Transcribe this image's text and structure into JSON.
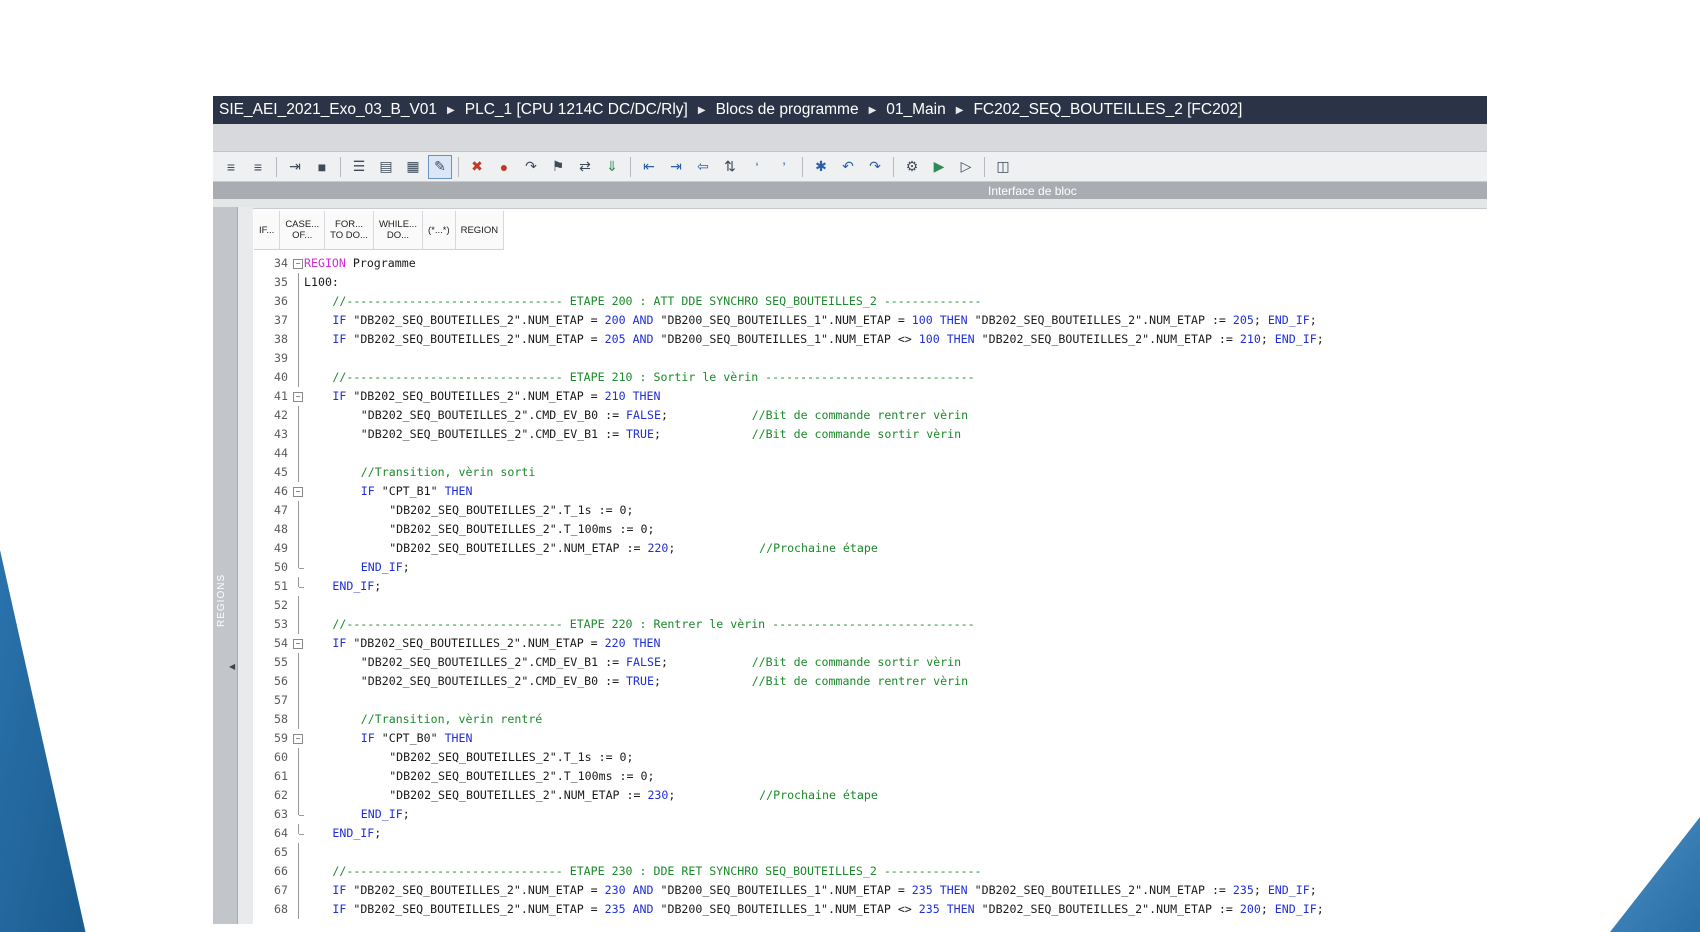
{
  "breadcrumb": [
    "SIE_AEI_2021_Exo_03_B_V01",
    "PLC_1 [CPU 1214C DC/DC/Rly]",
    "Blocs de programme",
    "01_Main",
    "FC202_SEQ_BOUTEILLES_2 [FC202]"
  ],
  "interface_label": "Interface de bloc",
  "regions_label": "REGIONS",
  "snippets": [
    {
      "l1": "IF...",
      "l2": ""
    },
    {
      "l1": "CASE...",
      "l2": "OF..."
    },
    {
      "l1": "FOR...",
      "l2": "TO DO..."
    },
    {
      "l1": "WHILE...",
      "l2": "DO..."
    },
    {
      "l1": "(*...*)",
      "l2": ""
    },
    {
      "l1": "REGION",
      "l2": ""
    }
  ],
  "code_lines": [
    {
      "n": "34",
      "fold": "box",
      "indent": 0,
      "parts": [
        [
          "kwr",
          "REGION"
        ],
        [
          "txt",
          " Programme"
        ]
      ]
    },
    {
      "n": "35",
      "fold": "vline",
      "indent": 0,
      "parts": [
        [
          "txt",
          "L100:"
        ]
      ]
    },
    {
      "n": "36",
      "fold": "vline",
      "indent": 1,
      "parts": [
        [
          "cmt",
          "//------------------------------- ETAPE 200 : ATT DDE SYNCHRO SEQ_BOUTEILLES_2 --------------"
        ]
      ]
    },
    {
      "n": "37",
      "fold": "vline",
      "indent": 1,
      "parts": [
        [
          "kw",
          "IF"
        ],
        [
          "txt",
          " \"DB202_SEQ_BOUTEILLES_2\".NUM_ETAP = "
        ],
        [
          "kw",
          "200"
        ],
        [
          "txt",
          " "
        ],
        [
          "kw",
          "AND"
        ],
        [
          "txt",
          " \"DB200_SEQ_BOUTEILLES_1\".NUM_ETAP = "
        ],
        [
          "kw",
          "100"
        ],
        [
          "txt",
          " "
        ],
        [
          "kw",
          "THEN"
        ],
        [
          "txt",
          " \"DB202_SEQ_BOUTEILLES_2\".NUM_ETAP := "
        ],
        [
          "kw",
          "205"
        ],
        [
          "txt",
          "; "
        ],
        [
          "kw",
          "END_IF"
        ],
        [
          "txt",
          ";"
        ]
      ]
    },
    {
      "n": "38",
      "fold": "vline",
      "indent": 1,
      "parts": [
        [
          "kw",
          "IF"
        ],
        [
          "txt",
          " \"DB202_SEQ_BOUTEILLES_2\".NUM_ETAP = "
        ],
        [
          "kw",
          "205"
        ],
        [
          "txt",
          " "
        ],
        [
          "kw",
          "AND"
        ],
        [
          "txt",
          " \"DB200_SEQ_BOUTEILLES_1\".NUM_ETAP <> "
        ],
        [
          "kw",
          "100"
        ],
        [
          "txt",
          " "
        ],
        [
          "kw",
          "THEN"
        ],
        [
          "txt",
          " \"DB202_SEQ_BOUTEILLES_2\".NUM_ETAP := "
        ],
        [
          "kw",
          "210"
        ],
        [
          "txt",
          "; "
        ],
        [
          "kw",
          "END_IF"
        ],
        [
          "txt",
          ";"
        ]
      ]
    },
    {
      "n": "39",
      "fold": "vline",
      "indent": 0,
      "parts": []
    },
    {
      "n": "40",
      "fold": "vline",
      "indent": 1,
      "parts": [
        [
          "cmt",
          "//------------------------------- ETAPE 210 : Sortir le vèrin ------------------------------"
        ]
      ]
    },
    {
      "n": "41",
      "fold": "box",
      "indent": 1,
      "parts": [
        [
          "kw",
          "IF"
        ],
        [
          "txt",
          " \"DB202_SEQ_BOUTEILLES_2\".NUM_ETAP = "
        ],
        [
          "kw",
          "210"
        ],
        [
          "txt",
          " "
        ],
        [
          "kw",
          "THEN"
        ]
      ]
    },
    {
      "n": "42",
      "fold": "vline",
      "indent": 2,
      "parts": [
        [
          "txt",
          "\"DB202_SEQ_BOUTEILLES_2\".CMD_EV_B0 := "
        ],
        [
          "kw",
          "FALSE"
        ],
        [
          "txt",
          ";            "
        ],
        [
          "cmt",
          "//Bit de commande rentrer vèrin"
        ]
      ]
    },
    {
      "n": "43",
      "fold": "vline",
      "indent": 2,
      "parts": [
        [
          "txt",
          "\"DB202_SEQ_BOUTEILLES_2\".CMD_EV_B1 := "
        ],
        [
          "kw",
          "TRUE"
        ],
        [
          "txt",
          ";             "
        ],
        [
          "cmt",
          "//Bit de commande sortir vèrin"
        ]
      ]
    },
    {
      "n": "44",
      "fold": "vline",
      "indent": 0,
      "parts": []
    },
    {
      "n": "45",
      "fold": "vline",
      "indent": 2,
      "parts": [
        [
          "cmt",
          "//Transition, vèrin sorti"
        ]
      ]
    },
    {
      "n": "46",
      "fold": "box",
      "indent": 2,
      "parts": [
        [
          "kw",
          "IF"
        ],
        [
          "txt",
          " \"CPT_B1\" "
        ],
        [
          "kw",
          "THEN"
        ]
      ]
    },
    {
      "n": "47",
      "fold": "vline",
      "indent": 3,
      "parts": [
        [
          "txt",
          "\"DB202_SEQ_BOUTEILLES_2\".T_1s := 0;"
        ]
      ]
    },
    {
      "n": "48",
      "fold": "vline",
      "indent": 3,
      "parts": [
        [
          "txt",
          "\"DB202_SEQ_BOUTEILLES_2\".T_100ms := 0;"
        ]
      ]
    },
    {
      "n": "49",
      "fold": "vline",
      "indent": 3,
      "parts": [
        [
          "txt",
          "\"DB202_SEQ_BOUTEILLES_2\".NUM_ETAP := "
        ],
        [
          "kw",
          "220"
        ],
        [
          "txt",
          ";            "
        ],
        [
          "cmt",
          "//Prochaine étape"
        ]
      ]
    },
    {
      "n": "50",
      "fold": "end",
      "indent": 2,
      "parts": [
        [
          "kw",
          "END_IF"
        ],
        [
          "txt",
          ";"
        ]
      ]
    },
    {
      "n": "51",
      "fold": "end",
      "indent": 1,
      "parts": [
        [
          "kw",
          "END_IF"
        ],
        [
          "txt",
          ";"
        ]
      ]
    },
    {
      "n": "52",
      "fold": "vline",
      "indent": 0,
      "parts": []
    },
    {
      "n": "53",
      "fold": "vline",
      "indent": 1,
      "parts": [
        [
          "cmt",
          "//------------------------------- ETAPE 220 : Rentrer le vèrin -----------------------------"
        ]
      ]
    },
    {
      "n": "54",
      "fold": "box",
      "indent": 1,
      "parts": [
        [
          "kw",
          "IF"
        ],
        [
          "txt",
          " \"DB202_SEQ_BOUTEILLES_2\".NUM_ETAP = "
        ],
        [
          "kw",
          "220"
        ],
        [
          "txt",
          " "
        ],
        [
          "kw",
          "THEN"
        ]
      ]
    },
    {
      "n": "55",
      "fold": "vline",
      "indent": 2,
      "parts": [
        [
          "txt",
          "\"DB202_SEQ_BOUTEILLES_2\".CMD_EV_B1 := "
        ],
        [
          "kw",
          "FALSE"
        ],
        [
          "txt",
          ";            "
        ],
        [
          "cmt",
          "//Bit de commande sortir vèrin"
        ]
      ]
    },
    {
      "n": "56",
      "fold": "vline",
      "indent": 2,
      "parts": [
        [
          "txt",
          "\"DB202_SEQ_BOUTEILLES_2\".CMD_EV_B0 := "
        ],
        [
          "kw",
          "TRUE"
        ],
        [
          "txt",
          ";             "
        ],
        [
          "cmt",
          "//Bit de commande rentrer vèrin"
        ]
      ]
    },
    {
      "n": "57",
      "fold": "vline",
      "indent": 0,
      "parts": []
    },
    {
      "n": "58",
      "fold": "vline",
      "indent": 2,
      "parts": [
        [
          "cmt",
          "//Transition, vèrin rentré"
        ]
      ]
    },
    {
      "n": "59",
      "fold": "box",
      "indent": 2,
      "parts": [
        [
          "kw",
          "IF"
        ],
        [
          "txt",
          " \"CPT_B0\" "
        ],
        [
          "kw",
          "THEN"
        ]
      ]
    },
    {
      "n": "60",
      "fold": "vline",
      "indent": 3,
      "parts": [
        [
          "txt",
          "\"DB202_SEQ_BOUTEILLES_2\".T_1s := 0;"
        ]
      ]
    },
    {
      "n": "61",
      "fold": "vline",
      "indent": 3,
      "parts": [
        [
          "txt",
          "\"DB202_SEQ_BOUTEILLES_2\".T_100ms := 0;"
        ]
      ]
    },
    {
      "n": "62",
      "fold": "vline",
      "indent": 3,
      "parts": [
        [
          "txt",
          "\"DB202_SEQ_BOUTEILLES_2\".NUM_ETAP := "
        ],
        [
          "kw",
          "230"
        ],
        [
          "txt",
          ";            "
        ],
        [
          "cmt",
          "//Prochaine étape"
        ]
      ]
    },
    {
      "n": "63",
      "fold": "end",
      "indent": 2,
      "parts": [
        [
          "kw",
          "END_IF"
        ],
        [
          "txt",
          ";"
        ]
      ]
    },
    {
      "n": "64",
      "fold": "end",
      "indent": 1,
      "parts": [
        [
          "kw",
          "END_IF"
        ],
        [
          "txt",
          ";"
        ]
      ]
    },
    {
      "n": "65",
      "fold": "vline",
      "indent": 0,
      "parts": []
    },
    {
      "n": "66",
      "fold": "vline",
      "indent": 1,
      "parts": [
        [
          "cmt",
          "//------------------------------- ETAPE 230 : DDE RET SYNCHRO SEQ_BOUTEILLES_2 --------------"
        ]
      ]
    },
    {
      "n": "67",
      "fold": "vline",
      "indent": 1,
      "parts": [
        [
          "kw",
          "IF"
        ],
        [
          "txt",
          " \"DB202_SEQ_BOUTEILLES_2\".NUM_ETAP = "
        ],
        [
          "kw",
          "230"
        ],
        [
          "txt",
          " "
        ],
        [
          "kw",
          "AND"
        ],
        [
          "txt",
          " \"DB200_SEQ_BOUTEILLES_1\".NUM_ETAP = "
        ],
        [
          "kw",
          "235"
        ],
        [
          "txt",
          " "
        ],
        [
          "kw",
          "THEN"
        ],
        [
          "txt",
          " \"DB202_SEQ_BOUTEILLES_2\".NUM_ETAP := "
        ],
        [
          "kw",
          "235"
        ],
        [
          "txt",
          "; "
        ],
        [
          "kw",
          "END_IF"
        ],
        [
          "txt",
          ";"
        ]
      ]
    },
    {
      "n": "68",
      "fold": "vline",
      "indent": 1,
      "parts": [
        [
          "kw",
          "IF"
        ],
        [
          "txt",
          " \"DB202_SEQ_BOUTEILLES_2\".NUM_ETAP = "
        ],
        [
          "kw",
          "235"
        ],
        [
          "txt",
          " "
        ],
        [
          "kw",
          "AND"
        ],
        [
          "txt",
          " \"DB200_SEQ_BOUTEILLES_1\".NUM_ETAP <> "
        ],
        [
          "kw",
          "235"
        ],
        [
          "txt",
          " "
        ],
        [
          "kw",
          "THEN"
        ],
        [
          "txt",
          " \"DB202_SEQ_BOUTEILLES_2\".NUM_ETAP := "
        ],
        [
          "kw",
          "200"
        ],
        [
          "txt",
          "; "
        ],
        [
          "kw",
          "END_IF"
        ],
        [
          "txt",
          ";"
        ]
      ]
    }
  ]
}
